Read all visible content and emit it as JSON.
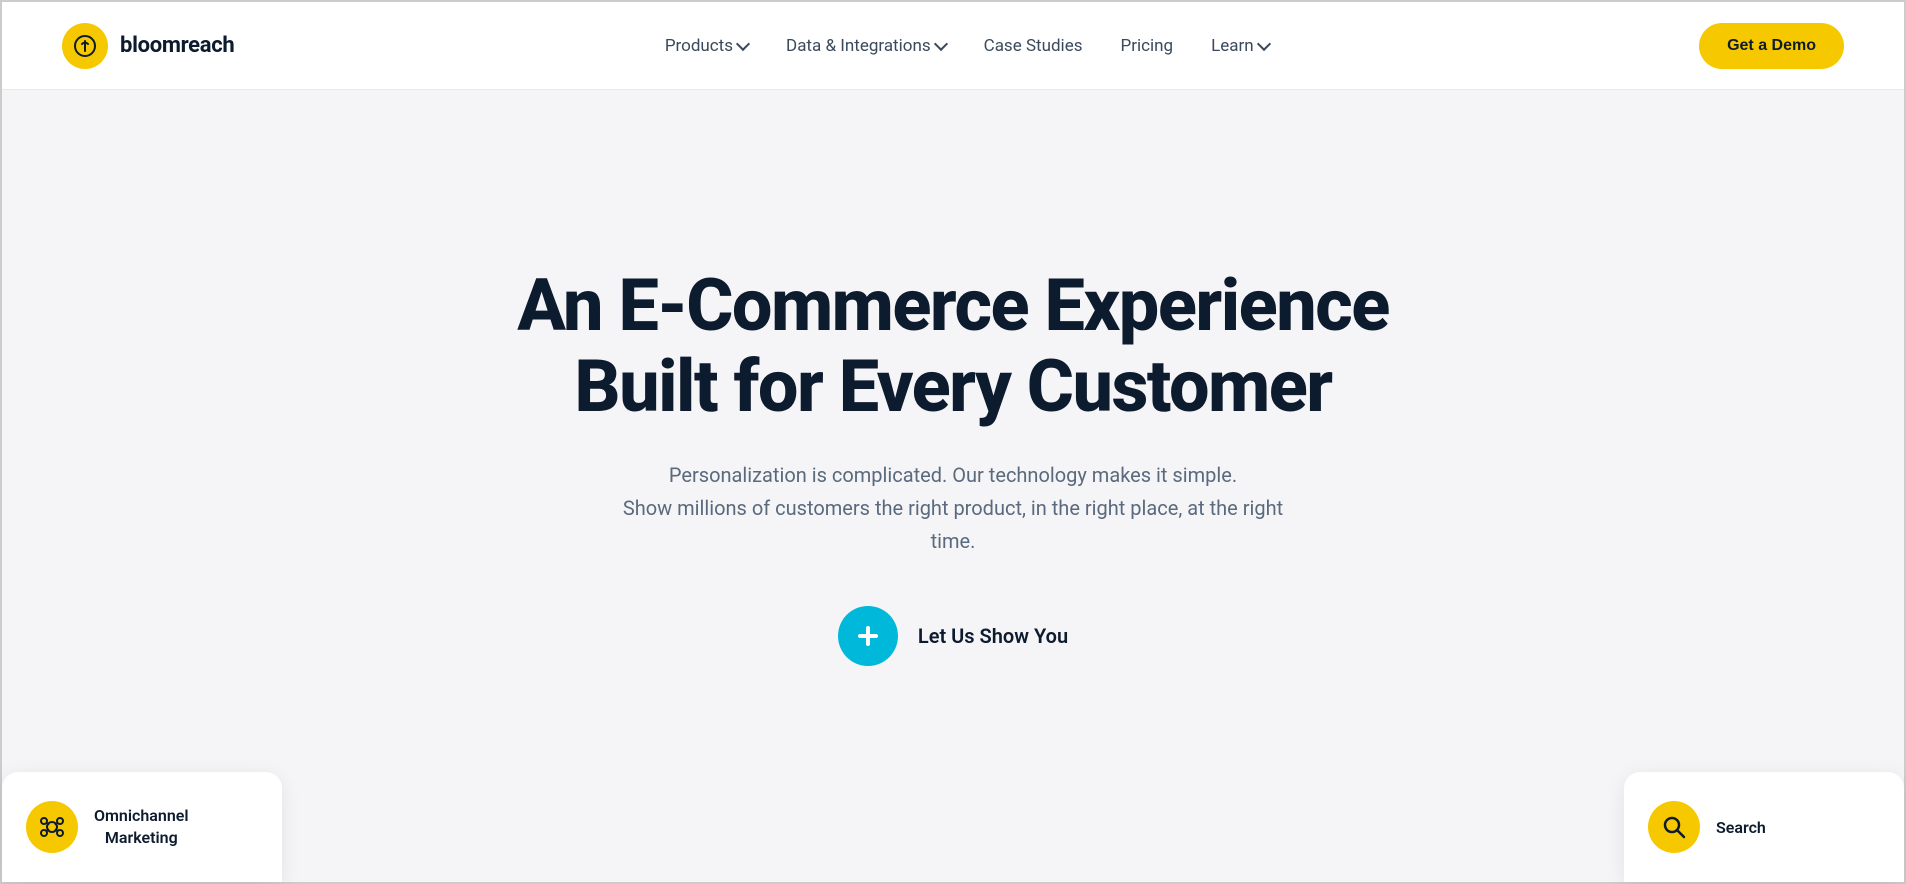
{
  "brand": {
    "name": "bloomreach",
    "logo_alt": "bloomreach logo"
  },
  "nav": {
    "items": [
      {
        "label": "Products",
        "has_dropdown": true
      },
      {
        "label": "Data & Integrations",
        "has_dropdown": true
      },
      {
        "label": "Case Studies",
        "has_dropdown": false
      },
      {
        "label": "Pricing",
        "has_dropdown": false
      },
      {
        "label": "Learn",
        "has_dropdown": true
      }
    ],
    "cta_button": "Get a Demo"
  },
  "hero": {
    "title": "An E-Commerce Experience Built for Every Customer",
    "subtitle_line1": "Personalization is complicated. Our technology makes it simple.",
    "subtitle_line2": "Show millions of customers the right product, in the right place, at the right time.",
    "cta_label": "Let Us Show You"
  },
  "bottom_cards": {
    "left_label_line1": "Omnichannel",
    "left_label_line2": "Marketing",
    "right_label": "Search"
  },
  "colors": {
    "yellow": "#f5c800",
    "teal": "#00b8d9",
    "dark_navy": "#0d1b2e",
    "text_muted": "#5a6a7e"
  }
}
